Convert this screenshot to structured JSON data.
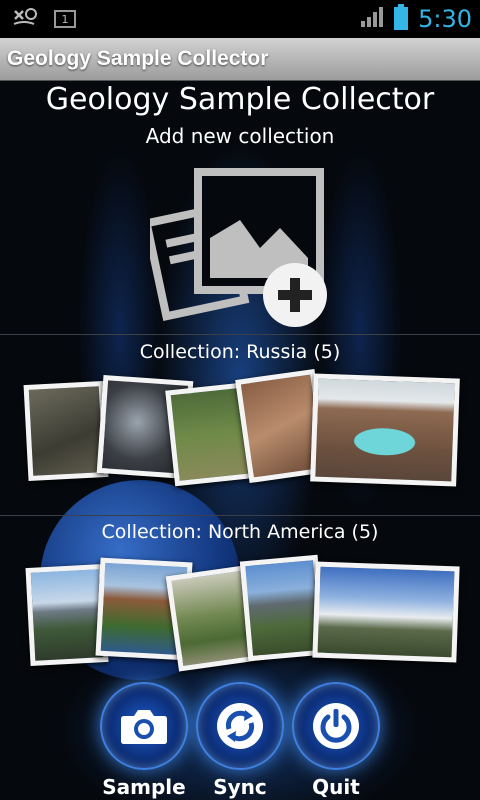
{
  "status_bar": {
    "time": "5:30",
    "notification_count": "1",
    "icons": [
      "missed-call-icon",
      "notification-count-icon",
      "signal-icon",
      "battery-icon"
    ]
  },
  "title_bar": {
    "title": "Geology Sample Collector"
  },
  "header": {
    "app_title": "Geology Sample Collector",
    "add_label": "Add new collection"
  },
  "collections": [
    {
      "label": "Collection: Russia (5)"
    },
    {
      "label": "Collection: North America (5)"
    }
  ],
  "buttons": {
    "sample": "Sample",
    "sync": "Sync",
    "quit": "Quit"
  },
  "colors": {
    "accent": "#33b5e5",
    "button_glow": "#3f7fe0"
  }
}
